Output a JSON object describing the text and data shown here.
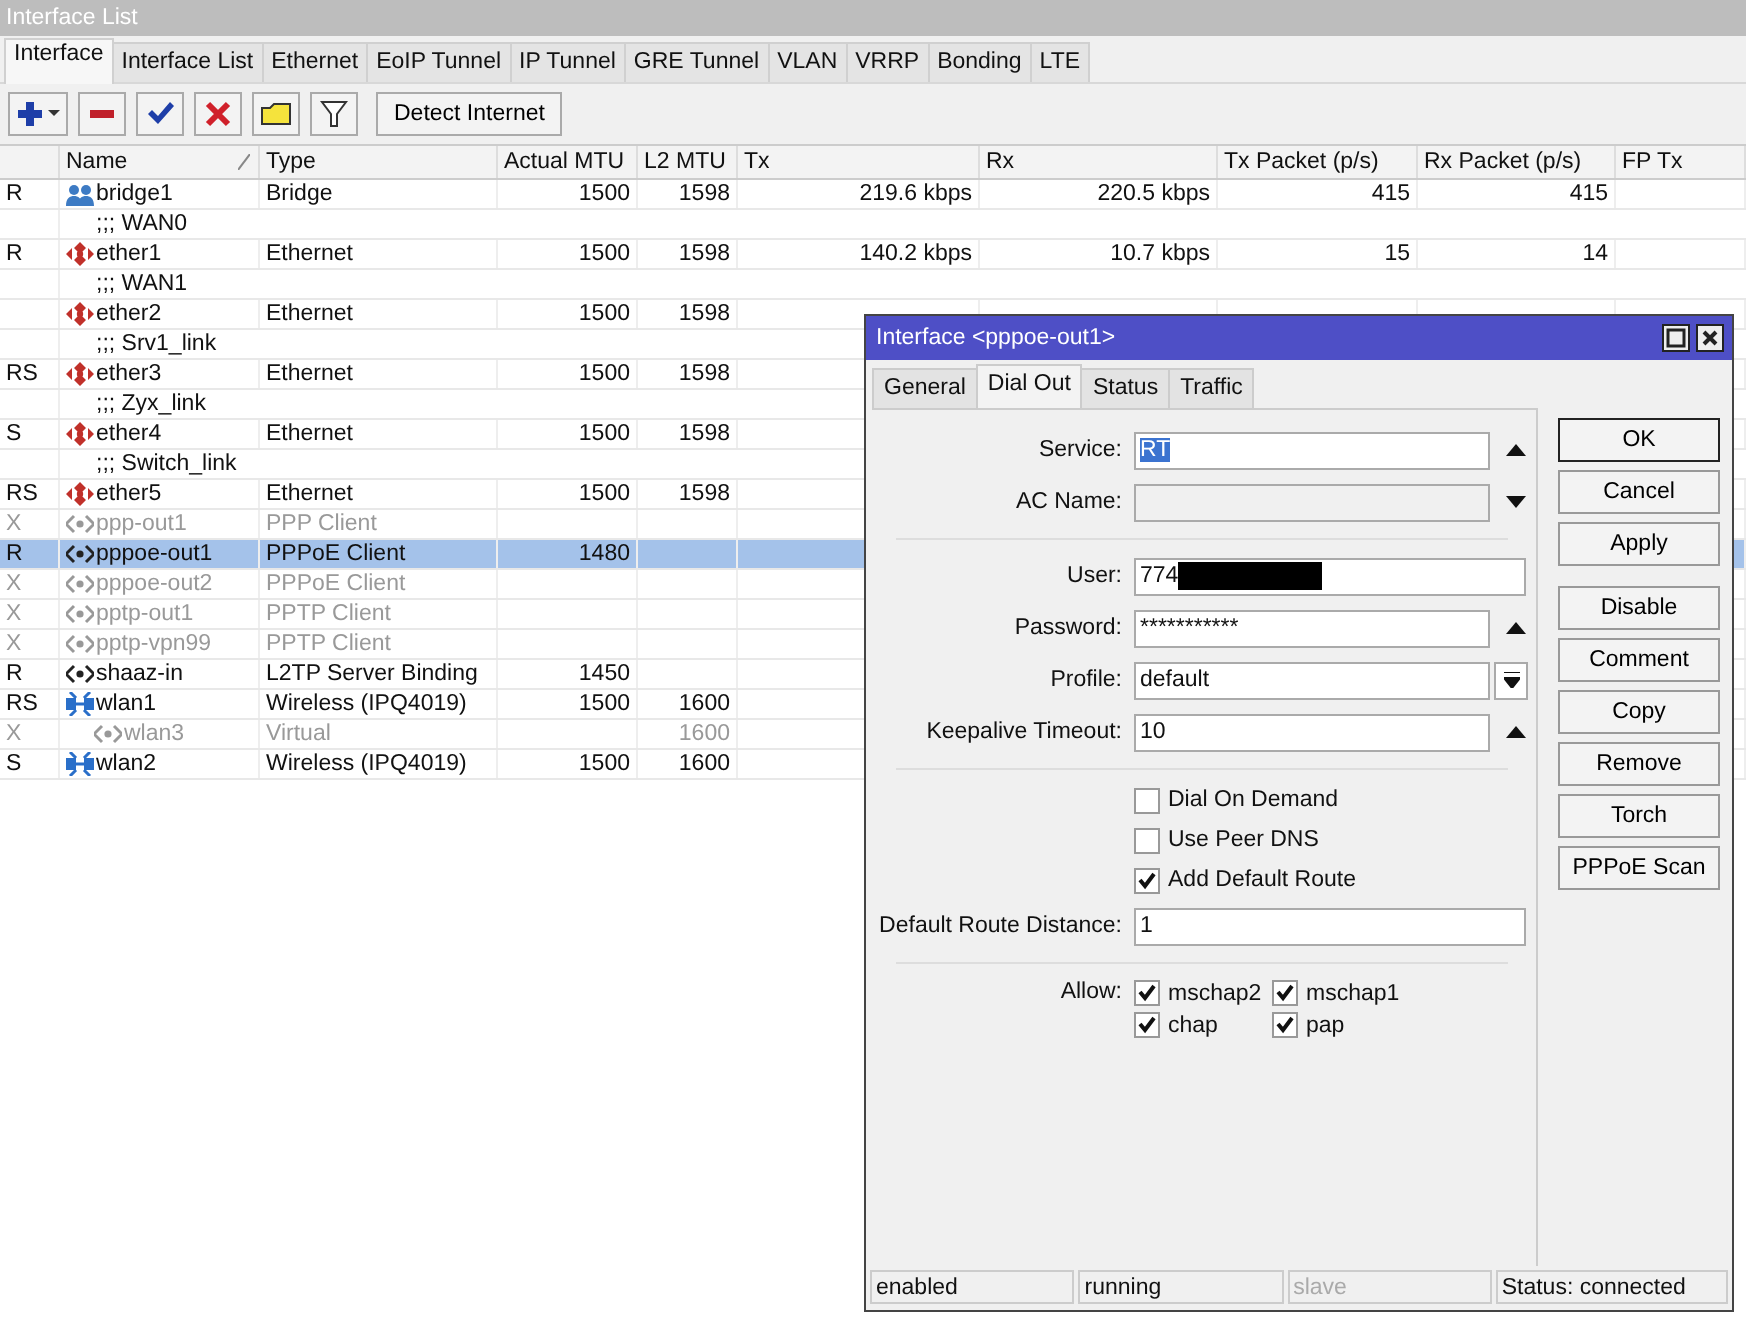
{
  "window": {
    "title": "Interface List"
  },
  "tabs": [
    {
      "label": "Interface",
      "selected": true
    },
    {
      "label": "Interface List",
      "selected": false
    },
    {
      "label": "Ethernet",
      "selected": false
    },
    {
      "label": "EoIP Tunnel",
      "selected": false
    },
    {
      "label": "IP Tunnel",
      "selected": false
    },
    {
      "label": "GRE Tunnel",
      "selected": false
    },
    {
      "label": "VLAN",
      "selected": false
    },
    {
      "label": "VRRP",
      "selected": false
    },
    {
      "label": "Bonding",
      "selected": false
    },
    {
      "label": "LTE",
      "selected": false
    }
  ],
  "toolbar": [
    {
      "kind": "add"
    },
    {
      "kind": "remove"
    },
    {
      "kind": "enable"
    },
    {
      "kind": "disable"
    },
    {
      "kind": "comment"
    },
    {
      "kind": "filter"
    },
    {
      "kind": "text",
      "label": "Detect Internet"
    }
  ],
  "table": {
    "columns": [
      {
        "label": "Name",
        "sorted": true
      },
      {
        "label": "Type",
        "sorted": false
      },
      {
        "label": "Actual MTU",
        "sorted": false
      },
      {
        "label": "L2 MTU",
        "sorted": false
      },
      {
        "label": "Tx",
        "sorted": false
      },
      {
        "label": "Rx",
        "sorted": false
      },
      {
        "label": "Tx Packet (p/s)",
        "sorted": false
      },
      {
        "label": "Rx Packet (p/s)",
        "sorted": false
      },
      {
        "label": "FP Tx",
        "sorted": false
      }
    ],
    "rows": [
      {
        "kind": "bridge",
        "flags": "R",
        "name": "bridge1",
        "type": "Bridge",
        "actual_mtu": "1500",
        "l2_mtu": "1598",
        "tx": "219.6 kbps",
        "rx": "220.5 kbps",
        "tx_packet": "415",
        "rx_packet": "415",
        "disabled": false,
        "selected": false
      },
      {
        "kind": "comment",
        "text": ";;; WAN0",
        "selected": false
      },
      {
        "kind": "ethernet",
        "flags": "R",
        "name": "ether1",
        "type": "Ethernet",
        "actual_mtu": "1500",
        "l2_mtu": "1598",
        "tx": "140.2 kbps",
        "rx": "10.7 kbps",
        "tx_packet": "15",
        "rx_packet": "14",
        "disabled": false,
        "selected": false
      },
      {
        "kind": "comment",
        "text": ";;; WAN1",
        "selected": false
      },
      {
        "kind": "ethernet",
        "name": "ether2",
        "type": "Ethernet",
        "actual_mtu": "1500",
        "l2_mtu": "1598",
        "disabled": false,
        "selected": false
      },
      {
        "kind": "comment",
        "text": ";;; Srv1_link",
        "selected": false
      },
      {
        "kind": "ethernet",
        "flags": "RS",
        "name": "ether3",
        "type": "Ethernet",
        "actual_mtu": "1500",
        "l2_mtu": "1598",
        "disabled": false,
        "selected": false
      },
      {
        "kind": "comment",
        "text": ";;; Zyx_link",
        "selected": false
      },
      {
        "kind": "ethernet",
        "flags": "S",
        "name": "ether4",
        "type": "Ethernet",
        "actual_mtu": "1500",
        "l2_mtu": "1598",
        "disabled": false,
        "selected": false
      },
      {
        "kind": "comment",
        "text": ";;; Switch_link",
        "selected": false
      },
      {
        "kind": "ethernet",
        "flags": "RS",
        "name": "ether5",
        "type": "Ethernet",
        "actual_mtu": "1500",
        "l2_mtu": "1598",
        "disabled": false,
        "selected": false
      },
      {
        "kind": "tunnel",
        "flags": "X",
        "name": "ppp-out1",
        "type": "PPP Client",
        "disabled": true,
        "selected": false
      },
      {
        "kind": "tunnel",
        "flags": "R",
        "name": "pppoe-out1",
        "type": "PPPoE Client",
        "actual_mtu": "1480",
        "disabled": false,
        "selected": true
      },
      {
        "kind": "tunnel",
        "flags": "X",
        "name": "pppoe-out2",
        "type": "PPPoE Client",
        "disabled": true,
        "selected": false
      },
      {
        "kind": "tunnel",
        "flags": "X",
        "name": "pptp-out1",
        "type": "PPTP Client",
        "disabled": true,
        "selected": false
      },
      {
        "kind": "tunnel",
        "flags": "X",
        "name": "pptp-vpn99",
        "type": "PPTP Client",
        "disabled": true,
        "selected": false
      },
      {
        "kind": "tunnel",
        "flags": "R",
        "name": "shaaz-in",
        "type": "L2TP Server Binding",
        "actual_mtu": "1450",
        "disabled": false,
        "selected": false
      },
      {
        "kind": "wireless",
        "flags": "RS",
        "name": "wlan1",
        "type": "Wireless (IPQ4019)",
        "actual_mtu": "1500",
        "l2_mtu": "1600",
        "disabled": false,
        "selected": false,
        "children": [
          {
            "kind": "tunnel",
            "flags": "X",
            "name": "wlan3",
            "type": "Virtual",
            "l2_mtu": "1600",
            "disabled": true,
            "selected": false
          }
        ]
      },
      {
        "kind": "wireless",
        "flags": "S",
        "name": "wlan2",
        "type": "Wireless (IPQ4019)",
        "actual_mtu": "1500",
        "l2_mtu": "1600",
        "disabled": false,
        "selected": false
      }
    ]
  },
  "dialog": {
    "title": "Interface <pppoe-out1>",
    "tabs": [
      {
        "label": "General",
        "selected": false
      },
      {
        "label": "Dial Out",
        "selected": true
      },
      {
        "label": "Status",
        "selected": false
      },
      {
        "label": "Traffic",
        "selected": false
      }
    ],
    "fields": [
      {
        "kind": "spinner",
        "label": "Service:",
        "value": "RT",
        "value_selected": true,
        "disabled": false
      },
      {
        "kind": "combo",
        "label": "AC Name:",
        "disabled": true
      },
      {
        "kind": "divider"
      },
      {
        "kind": "text",
        "label": "User:",
        "value": "774",
        "redacted": true,
        "disabled": false
      },
      {
        "kind": "spinner",
        "label": "Password:",
        "value": "***********",
        "disabled": false
      },
      {
        "kind": "select",
        "label": "Profile:",
        "value": "default",
        "disabled": false
      },
      {
        "kind": "spinner",
        "label": "Keepalive Timeout:",
        "value": "10",
        "disabled": false
      },
      {
        "kind": "divider"
      },
      {
        "kind": "checkbox",
        "label": "Dial On Demand",
        "checked": false
      },
      {
        "kind": "checkbox",
        "label": "Use Peer DNS",
        "checked": false
      },
      {
        "kind": "checkbox",
        "label": "Add Default Route",
        "checked": true
      },
      {
        "kind": "text",
        "label": "Default Route Distance:",
        "value": "1",
        "disabled": false
      },
      {
        "kind": "divider"
      },
      {
        "kind": "allow",
        "label": "Allow:",
        "options": [
          {
            "label": "mschap2",
            "checked": true
          },
          {
            "label": "mschap1",
            "checked": true
          },
          {
            "label": "chap",
            "checked": true
          },
          {
            "label": "pap",
            "checked": true
          }
        ]
      }
    ],
    "buttons": [
      [
        {
          "label": "OK",
          "default": true
        },
        {
          "label": "Cancel",
          "default": false
        },
        {
          "label": "Apply",
          "default": false
        }
      ],
      [
        {
          "label": "Disable",
          "default": false
        },
        {
          "label": "Comment",
          "default": false
        },
        {
          "label": "Copy",
          "default": false
        },
        {
          "label": "Remove",
          "default": false
        },
        {
          "label": "Torch",
          "default": false
        },
        {
          "label": "PPPoE Scan",
          "default": false
        }
      ]
    ],
    "status_bar": [
      {
        "text": "enabled",
        "disabled": false
      },
      {
        "text": "running",
        "disabled": false
      },
      {
        "text": "slave",
        "disabled": true
      },
      {
        "text": "Status: connected",
        "disabled": false
      }
    ]
  }
}
